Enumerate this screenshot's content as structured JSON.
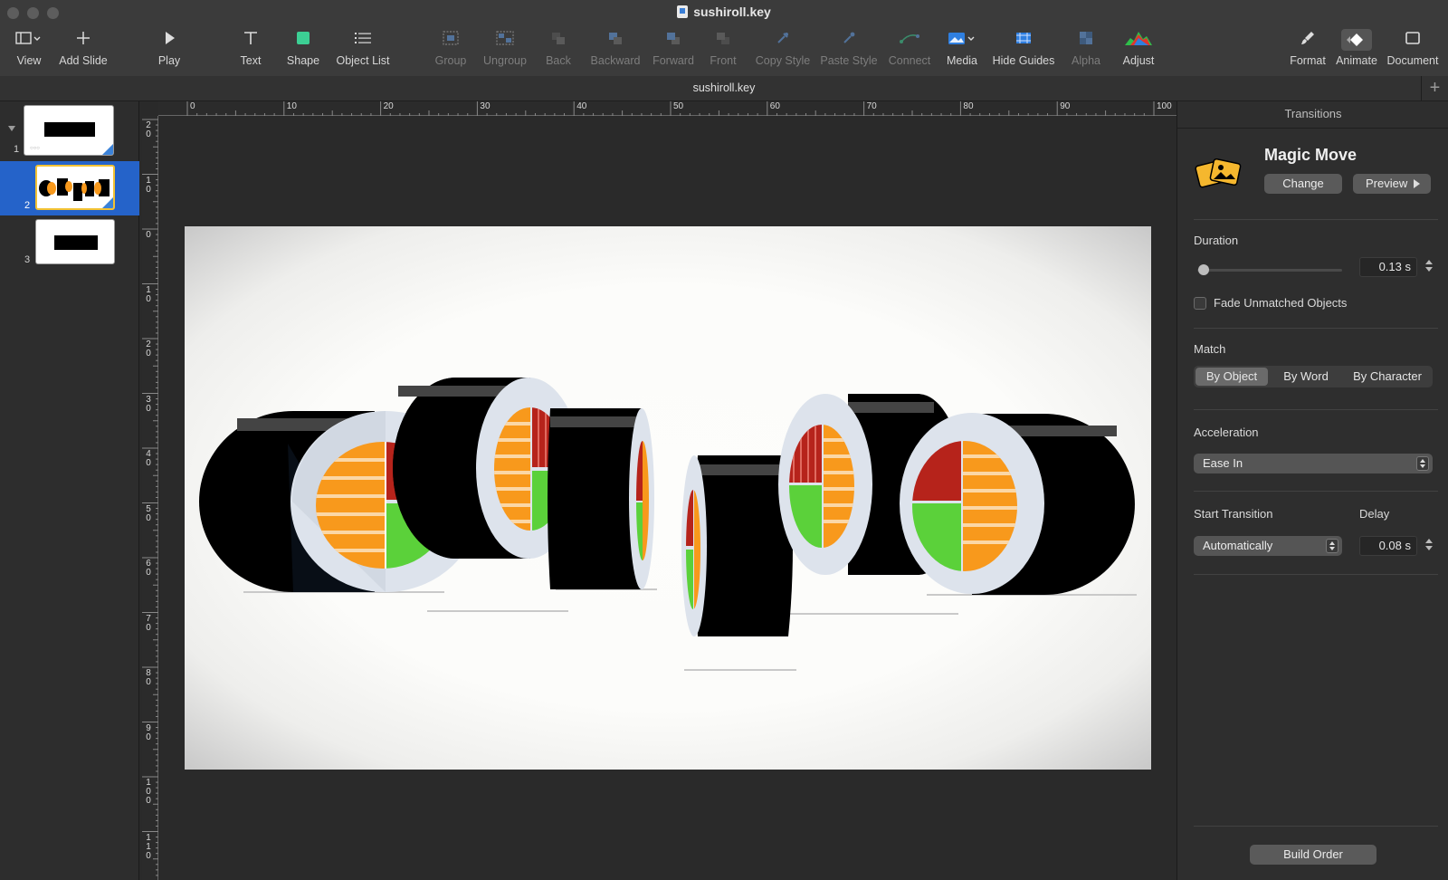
{
  "window": {
    "title": "sushiroll.key"
  },
  "toolbar": {
    "items": [
      {
        "label": "View",
        "icon": "sidebar-view-icon",
        "enabled": true
      },
      {
        "label": "Add Slide",
        "icon": "plus-icon",
        "enabled": true
      },
      {
        "label": "Play",
        "icon": "play-icon",
        "enabled": true
      },
      {
        "label": "Text",
        "icon": "text-icon",
        "enabled": true
      },
      {
        "label": "Shape",
        "icon": "shape-square-icon",
        "enabled": true
      },
      {
        "label": "Object List",
        "icon": "list-icon",
        "enabled": true
      },
      {
        "label": "Group",
        "icon": "group-icon",
        "enabled": false
      },
      {
        "label": "Ungroup",
        "icon": "ungroup-icon",
        "enabled": false
      },
      {
        "label": "Back",
        "icon": "send-back-icon",
        "enabled": false
      },
      {
        "label": "Backward",
        "icon": "send-backward-icon",
        "enabled": false
      },
      {
        "label": "Forward",
        "icon": "bring-forward-icon",
        "enabled": false
      },
      {
        "label": "Front",
        "icon": "bring-front-icon",
        "enabled": false
      },
      {
        "label": "Copy Style",
        "icon": "eyedropper-icon",
        "enabled": false
      },
      {
        "label": "Paste Style",
        "icon": "paste-style-icon",
        "enabled": false
      },
      {
        "label": "Connect",
        "icon": "connect-line-icon",
        "enabled": false
      },
      {
        "label": "Media",
        "icon": "media-photo-icon",
        "enabled": true
      },
      {
        "label": "Hide Guides",
        "icon": "guides-icon",
        "enabled": true
      },
      {
        "label": "Alpha",
        "icon": "alpha-icon",
        "enabled": false
      },
      {
        "label": "Adjust",
        "icon": "adjust-histogram-icon",
        "enabled": true
      },
      {
        "label": "Format",
        "icon": "paintbrush-icon",
        "enabled": true
      },
      {
        "label": "Animate",
        "icon": "diamond-animate-icon",
        "enabled": true
      },
      {
        "label": "Document",
        "icon": "document-square-icon",
        "enabled": true
      }
    ]
  },
  "tabbar": {
    "title": "sushiroll.key",
    "add_label": "+"
  },
  "navigator": {
    "slides": [
      {
        "number": "1",
        "selected": false
      },
      {
        "number": "2",
        "selected": true
      },
      {
        "number": "3",
        "selected": false
      }
    ]
  },
  "rulers": {
    "horizontal": [
      "0",
      "10",
      "20",
      "30",
      "40",
      "50",
      "60",
      "70",
      "80",
      "90",
      "100"
    ],
    "vertical": [
      "2\n0",
      "1\n0",
      "0",
      "1\n0",
      "2\n0",
      "3\n0",
      "4\n0",
      "5\n0",
      "6\n0",
      "7\n0",
      "8\n0",
      "9\n0",
      "1\n0\n0",
      "1\n1\n0"
    ]
  },
  "inspector": {
    "header": "Transitions",
    "effect_name": "Magic Move",
    "change_label": "Change",
    "preview_label": "Preview",
    "duration_label": "Duration",
    "duration_value": "0.13 s",
    "duration_fraction": 0.02,
    "fade_label": "Fade Unmatched Objects",
    "fade_checked": false,
    "match_label": "Match",
    "match_options": [
      "By Object",
      "By Word",
      "By Character"
    ],
    "match_selected": "By Object",
    "acceleration_label": "Acceleration",
    "acceleration_value": "Ease In",
    "start_label": "Start Transition",
    "start_value": "Automatically",
    "delay_label": "Delay",
    "delay_value": "0.08 s",
    "build_order_label": "Build Order"
  },
  "colors": {
    "accent": "#2563c9",
    "nori": "#000000",
    "salmon": "#f8991c",
    "cucumber": "#5bd13a",
    "tuna": "#b6231b",
    "rice": "#dde3ec"
  }
}
